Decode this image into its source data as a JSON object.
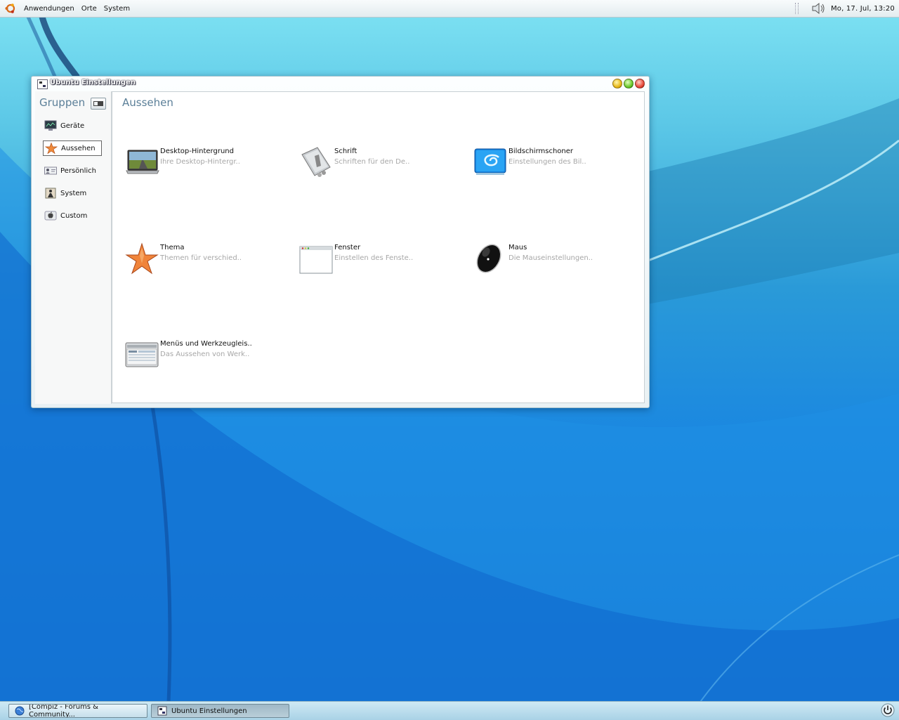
{
  "top_panel": {
    "menus": [
      "Anwendungen",
      "Orte",
      "System"
    ],
    "clock": "Mo, 17. Jul, 13:20",
    "volume_icon": "speaker-icon"
  },
  "window": {
    "title": "Ubuntu Einstellungen",
    "sidebar": {
      "title": "Gruppen",
      "items": [
        {
          "label": "Geräte",
          "icon": "monitor-icon",
          "selected": false
        },
        {
          "label": "Aussehen",
          "icon": "star-icon",
          "selected": true
        },
        {
          "label": "Persönlich",
          "icon": "person-card-icon",
          "selected": false
        },
        {
          "label": "System",
          "icon": "system-icon",
          "selected": false
        },
        {
          "label": "Custom",
          "icon": "apple-icon",
          "selected": false
        }
      ]
    },
    "content": {
      "title": "Aussehen",
      "items": [
        {
          "name": "Desktop-Hintergrund",
          "desc": "Ihre Desktop-Hintergr..",
          "icon": "laptop-wallpaper-icon"
        },
        {
          "name": "Schrift",
          "desc": "Schriften für den De..",
          "icon": "font-icon"
        },
        {
          "name": "Bildschirmschoner",
          "desc": "Einstellungen des Bil..",
          "icon": "screensaver-icon"
        },
        {
          "name": "Thema",
          "desc": "Themen für verschied..",
          "icon": "starfish-icon"
        },
        {
          "name": "Fenster",
          "desc": "Einstellen des Fenste..",
          "icon": "window-icon"
        },
        {
          "name": "Maus",
          "desc": "Die Mauseinstellungen..",
          "icon": "mouse-icon"
        },
        {
          "name": "Menüs und Werkzeugleis..",
          "desc": "Das Aussehen von Werk..",
          "icon": "toolbar-icon"
        }
      ]
    }
  },
  "taskbar": {
    "tasks": [
      {
        "label": "[Compiz - Forums & Community...",
        "icon": "globe-icon",
        "active": false
      },
      {
        "label": "Ubuntu Einstellungen",
        "icon": "window-app-icon",
        "active": true
      }
    ]
  },
  "colors": {
    "accent": "#5b7f98",
    "desc_text": "#a7a7a7"
  }
}
